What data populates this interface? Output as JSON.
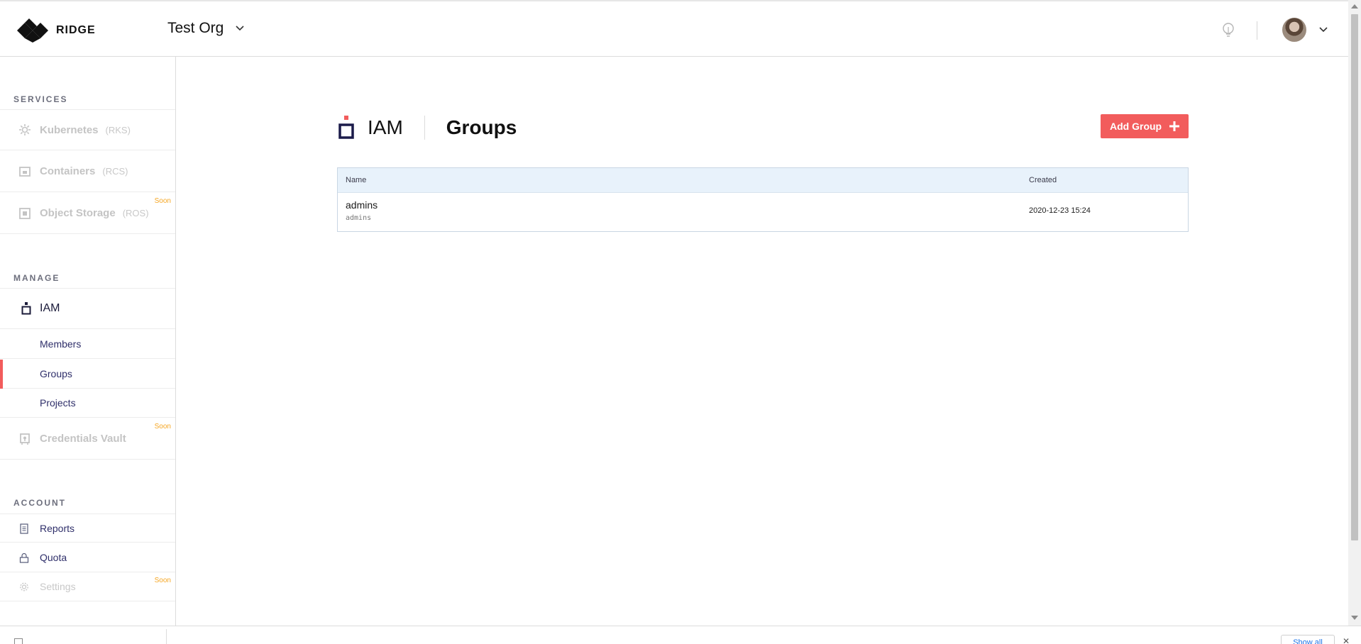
{
  "header": {
    "brand": "RIDGE",
    "org_name": "Test Org",
    "icons": [
      "ridge-logo-icon",
      "chevron-down-icon",
      "lightbulb-icon",
      "avatar",
      "chevron-down-icon"
    ]
  },
  "sidebar": {
    "services_title": "SERVICES",
    "services": [
      {
        "label": "Kubernetes",
        "abbr": "(RKS)",
        "icon": "kubernetes-icon"
      },
      {
        "label": "Containers",
        "abbr": "(RCS)",
        "icon": "container-icon"
      },
      {
        "label": "Object Storage",
        "abbr": "(ROS)",
        "badge": "Soon",
        "icon": "storage-icon"
      }
    ],
    "manage_title": "MANAGE",
    "iam": {
      "label": "IAM",
      "icon": "iam-icon"
    },
    "iam_sub": [
      {
        "label": "Members"
      },
      {
        "label": "Groups"
      },
      {
        "label": "Projects"
      }
    ],
    "vault": {
      "label": "Credentials Vault",
      "badge": "Soon",
      "icon": "vault-icon"
    },
    "account_title": "ACCOUNT",
    "account": [
      {
        "label": "Reports",
        "icon": "document-icon"
      },
      {
        "label": "Quota",
        "icon": "lock-icon"
      },
      {
        "label": "Settings",
        "badge": "Soon",
        "icon": "gear-icon"
      }
    ]
  },
  "main": {
    "section": "IAM",
    "title": "Groups",
    "add_button": "Add Group",
    "table": {
      "columns": [
        "Name",
        "Created"
      ],
      "rows": [
        {
          "name": "admins",
          "slug": "admins",
          "created": "2020-12-23 15:24"
        }
      ]
    }
  },
  "footer": {
    "show_all": "Show all",
    "close": "✕"
  },
  "colors": {
    "accent": "#f25c5c",
    "nav_text": "#2f2f6a",
    "soon_badge": "#f5a623",
    "table_header_bg": "#e8f2fb"
  }
}
